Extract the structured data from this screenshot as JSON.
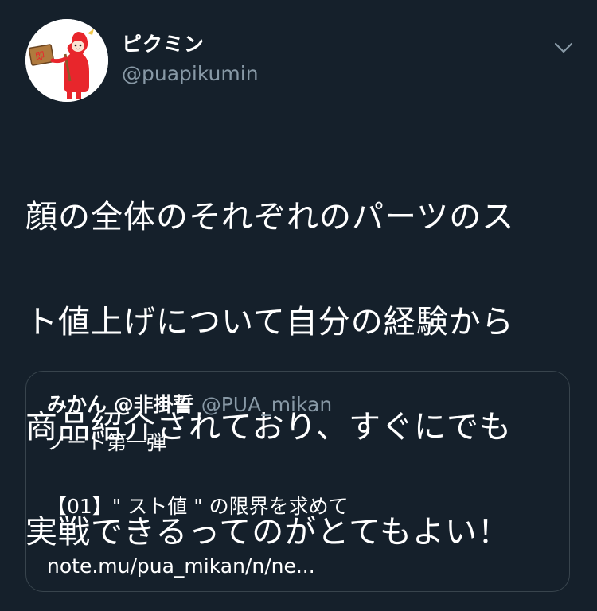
{
  "user": {
    "display_name": "ピクミン",
    "handle": "@puapikumin",
    "avatar_icon": "avatar-illustration-icon"
  },
  "tweet": {
    "text": "顔の全体のそれぞれのパーツのスト値上げについて自分の経験から商品紹介されており、すぐにでも実戦できるってのがとてもよい！",
    "lines": [
      "顔の全体のそれぞれのパーツのス",
      "ト値上げについて自分の経験から",
      "商品紹介されており、すぐにでも",
      "実戦できるってのがとてもよい！"
    ]
  },
  "menu": {
    "icon": "chevron-down-icon"
  },
  "quoted_tweet": {
    "display_name": "みかん @非掛誓",
    "handle": "@PUA_mikan",
    "line1": "ノート第一弾",
    "line2": "【01】\" スト値 \" の限界を求めて",
    "line3": "note.mu/pua_mikan/n/ne..."
  },
  "colors": {
    "background": "#15202b",
    "text_primary": "#ffffff",
    "text_secondary": "#8899a6",
    "border": "#38444d",
    "avatar_accent": "#e8262c"
  }
}
